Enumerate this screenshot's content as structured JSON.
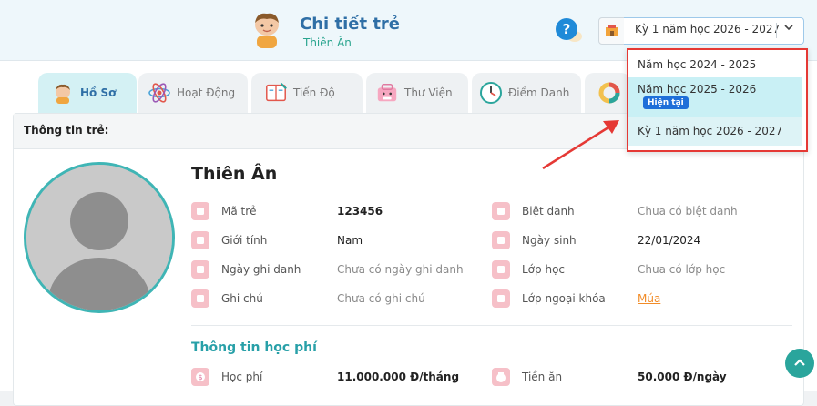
{
  "header": {
    "title": "Chi tiết trẻ",
    "subtitle": "Thiên Ân",
    "help_label": "?",
    "term_selected": "Kỳ 1 năm học 2026 - 2027"
  },
  "tabs": [
    {
      "label": "Hồ Sơ",
      "icon": "kid-face-icon",
      "active": true
    },
    {
      "label": "Hoạt Động",
      "icon": "atom-icon",
      "active": false
    },
    {
      "label": "Tiến Độ",
      "icon": "notebook-icon",
      "active": false
    },
    {
      "label": "Thư Viện",
      "icon": "bag-icon",
      "active": false
    },
    {
      "label": "Điểm Danh",
      "icon": "clock-icon",
      "active": false
    },
    {
      "label": "",
      "icon": "donut-chart-icon",
      "active": false
    }
  ],
  "profile": {
    "section_title": "Thông tin trẻ:",
    "name": "Thiên Ân",
    "fields_left": [
      {
        "label": "Mã trẻ",
        "value": "123456",
        "style": "strong",
        "icon": "id-card-icon"
      },
      {
        "label": "Giới tính",
        "value": "Nam",
        "style": "normal",
        "icon": "gender-icon"
      },
      {
        "label": "Ngày ghi danh",
        "value": "Chưa có ngày ghi danh",
        "style": "muted",
        "icon": "calendar-icon"
      },
      {
        "label": "Ghi chú",
        "value": "Chưa có ghi chú",
        "style": "muted",
        "icon": "note-icon"
      }
    ],
    "fields_right": [
      {
        "label": "Biệt danh",
        "value": "Chưa có biệt danh",
        "style": "muted",
        "icon": "user-icon"
      },
      {
        "label": "Ngày sinh",
        "value": "22/01/2024",
        "style": "normal",
        "icon": "calendar-icon"
      },
      {
        "label": "Lớp học",
        "value": "Chưa có lớp học",
        "style": "muted",
        "icon": "class-icon"
      },
      {
        "label": "Lớp ngoại khóa",
        "value": "Múa",
        "style": "link",
        "icon": "class-icon"
      }
    ]
  },
  "fees": {
    "title": "Thông tin học phí",
    "left": {
      "label": "Học phí",
      "value": "11.000.000 Đ/tháng",
      "icon": "tuition-icon"
    },
    "right": {
      "label": "Tiền ăn",
      "value": "50.000 Đ/ngày",
      "icon": "meal-icon"
    }
  },
  "dropdown": {
    "options": [
      {
        "label": "Năm học 2024 - 2025"
      },
      {
        "label": "Năm học 2025 - 2026",
        "badge": "Hiện tại"
      },
      {
        "label": "Kỳ 1 năm học 2026 - 2027"
      }
    ]
  },
  "colors": {
    "accent": "#2f6fa6",
    "teal": "#3fb5b5",
    "highlight_border": "#e53935",
    "badge": "#1e6fd9",
    "link": "#f28c28"
  }
}
